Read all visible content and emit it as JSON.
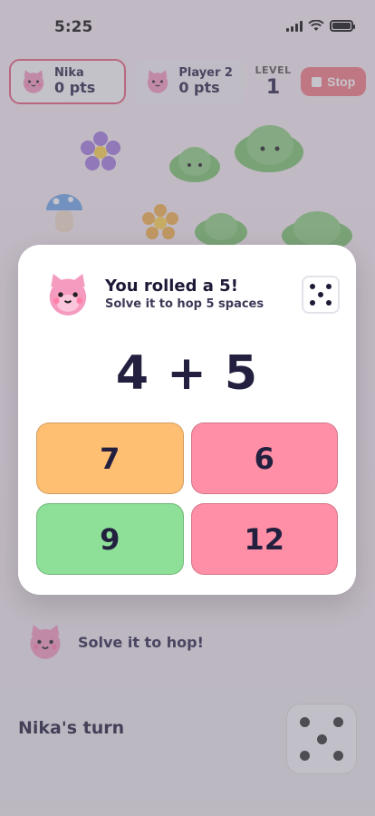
{
  "status": {
    "time": "5:25"
  },
  "header": {
    "player1": {
      "name": "Nika",
      "points": "0 pts"
    },
    "player2": {
      "name": "Player 2",
      "points": "0 pts"
    },
    "level": {
      "label": "LEVEL",
      "value": "1"
    },
    "stop_label": "Stop"
  },
  "board": {
    "hop_prompt": "Solve it to hop!",
    "turn_text": "Nika's turn"
  },
  "modal": {
    "title": "You rolled a 5!",
    "subtitle": "Solve it to hop 5 spaces",
    "die_value": 5,
    "equation": "4 + 5",
    "answers": [
      {
        "label": "7",
        "color": "#ffbf73"
      },
      {
        "label": "6",
        "color": "#ff8fa6"
      },
      {
        "label": "9",
        "color": "#8edf98"
      },
      {
        "label": "12",
        "color": "#ff8fa6"
      }
    ]
  },
  "colors": {
    "accent": "#e9607e",
    "stop": "#f37a83",
    "cat": "#f59bbf"
  }
}
